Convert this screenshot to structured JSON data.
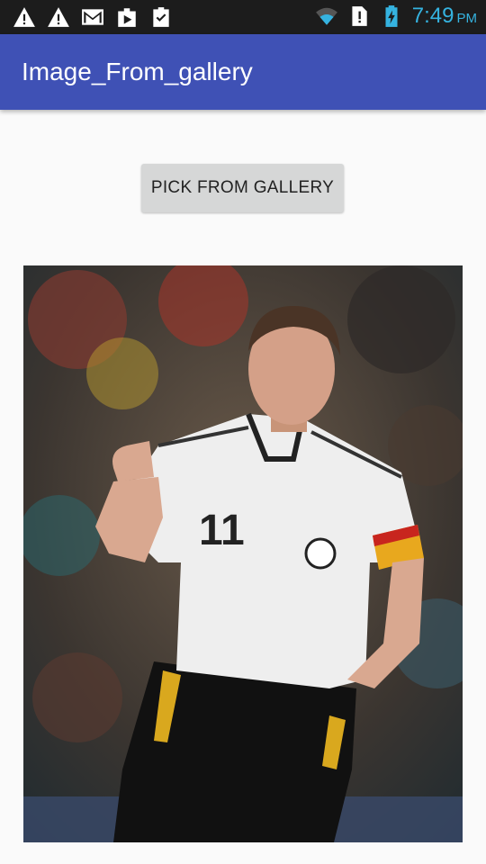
{
  "status_bar": {
    "time": "7:49",
    "ampm": "PM",
    "left_icons": [
      "warning-icon",
      "warning-icon",
      "gmail-icon",
      "play-store-icon",
      "clipboard-check-icon"
    ],
    "right_icons": [
      "wifi-icon",
      "no-sim-icon",
      "battery-charging-icon"
    ]
  },
  "app_bar": {
    "title": "Image_From_gallery"
  },
  "main": {
    "pick_button_label": "PICK FROM GALLERY",
    "image": {
      "subject": "soccer-player-photo"
    }
  },
  "colors": {
    "app_bar": "#3f51b5",
    "status_bar": "#1c1c1c",
    "clock": "#35b3e0",
    "button": "#d6d7d7",
    "background": "#fafafa"
  }
}
